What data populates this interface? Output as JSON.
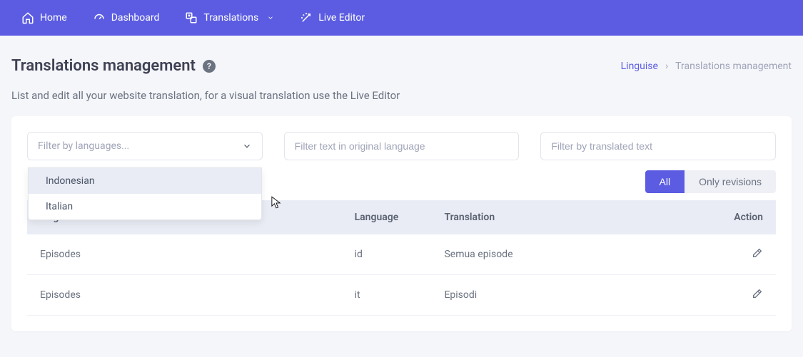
{
  "nav": {
    "home": "Home",
    "dashboard": "Dashboard",
    "translations": "Translations",
    "live_editor": "Live Editor"
  },
  "header": {
    "title": "Translations management",
    "subtitle": "List and edit all your website translation, for a visual translation use the Live Editor"
  },
  "breadcrumb": {
    "root": "Linguise",
    "sep": "›",
    "current": "Translations management"
  },
  "filters": {
    "lang_placeholder": "Filter by languages...",
    "original_placeholder": "Filter text in original language",
    "translated_placeholder": "Filter by translated text",
    "dropdown": [
      {
        "label": "Indonesian",
        "highlight": true
      },
      {
        "label": "Italian",
        "highlight": false
      }
    ]
  },
  "toggle": {
    "all": "All",
    "revisions": "Only revisions"
  },
  "table": {
    "cols": {
      "original": "Original",
      "language": "Language",
      "translation": "Translation",
      "action": "Action"
    },
    "rows": [
      {
        "original": "Episodes",
        "language": "id",
        "translation": "Semua episode"
      },
      {
        "original": "Episodes",
        "language": "it",
        "translation": "Episodi"
      }
    ]
  }
}
